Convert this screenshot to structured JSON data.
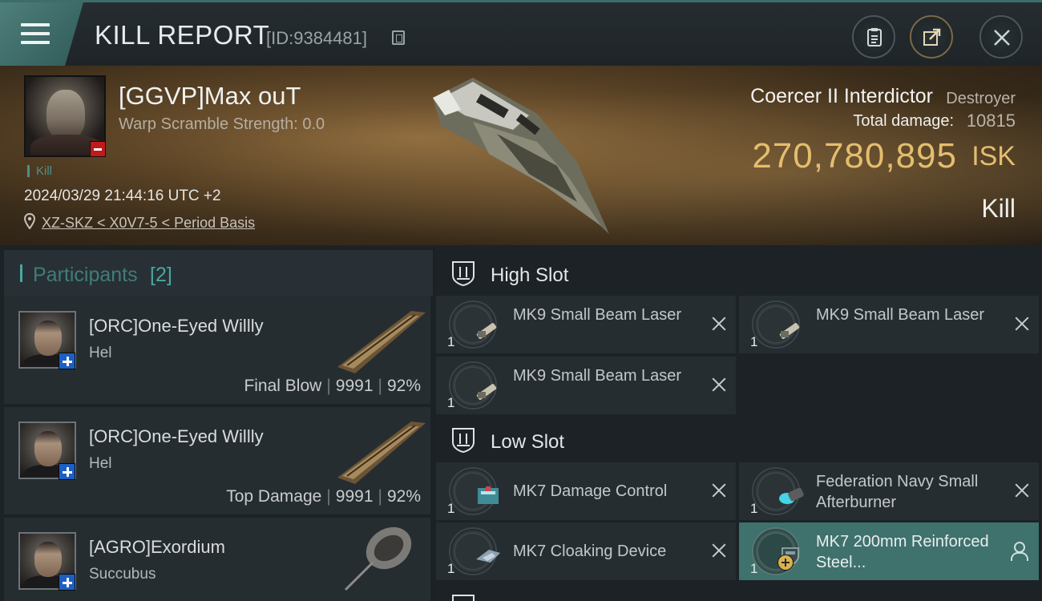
{
  "header": {
    "title": "KILL REPORT",
    "report_id": "[ID:9384481]"
  },
  "victim": {
    "name": "[GGVP]Max ouT",
    "warp_scramble": "Warp Scramble Strength: 0.0",
    "kill_tag": "Kill",
    "datetime": "2024/03/29 21:44:16 UTC +2",
    "location": "XZ-SKZ < X0V7-5 < Period Basis",
    "ship_name": "Coercer II Interdictor",
    "ship_class": "Destroyer",
    "total_damage_label": "Total damage:",
    "total_damage": "10815",
    "isk_value": "270,780,895",
    "isk_unit": "ISK",
    "kill_type": "Kill"
  },
  "participants": {
    "title": "Participants",
    "count": "[2]",
    "rows": [
      {
        "name": "[ORC]One-Eyed Willly",
        "ship": "Hel",
        "role": "Final Blow",
        "damage": "9991",
        "percent": "92%"
      },
      {
        "name": "[ORC]One-Eyed Willly",
        "ship": "Hel",
        "role": "Top Damage",
        "damage": "9991",
        "percent": "92%"
      },
      {
        "name": "[AGRO]Exordium",
        "ship": "Succubus"
      }
    ]
  },
  "fitting": {
    "high_slot": {
      "title": "High Slot",
      "modules": [
        {
          "qty": "1",
          "name": "MK9 Small Beam Laser"
        },
        {
          "qty": "1",
          "name": "MK9 Small Beam Laser"
        },
        {
          "qty": "1",
          "name": "MK9 Small Beam Laser"
        }
      ]
    },
    "low_slot": {
      "title": "Low Slot",
      "modules": [
        {
          "qty": "1",
          "name": "MK7 Damage Control"
        },
        {
          "qty": "1",
          "name": "Federation Navy Small Afterburner"
        },
        {
          "qty": "1",
          "name": "MK7 Cloaking Device"
        },
        {
          "qty": "1",
          "name": "MK7 200mm Reinforced Steel..."
        }
      ]
    }
  },
  "colors": {
    "accent": "#4aa6a0",
    "isk_gold": "#e4be6e",
    "highlight_row": "#3f716d"
  },
  "icons": [
    "menu-icon",
    "copy-icon",
    "report-icon",
    "share-icon",
    "close-icon",
    "location-pin-icon",
    "high-slot-icon",
    "low-slot-icon",
    "remove-x-icon",
    "person-icon"
  ]
}
